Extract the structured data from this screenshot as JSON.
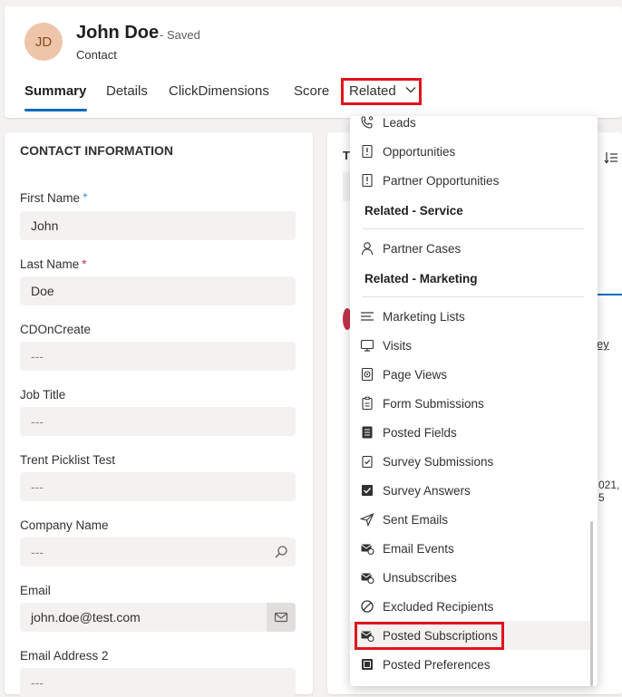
{
  "header": {
    "avatar_initials": "JD",
    "record_name": "John Doe",
    "saved_status": "- Saved",
    "entity_type": "Contact",
    "tabs": [
      {
        "label": "Summary"
      },
      {
        "label": "Details"
      },
      {
        "label": "ClickDimensions"
      },
      {
        "label": "Score"
      },
      {
        "label": "Related"
      }
    ],
    "active_tab": "Summary"
  },
  "contact_info": {
    "section_title": "CONTACT INFORMATION",
    "fields": [
      {
        "label": "First Name",
        "required_marker": "+",
        "value": "John"
      },
      {
        "label": "Last Name",
        "required_marker": "*",
        "value": "Doe"
      },
      {
        "label": "CDOnCreate",
        "value": "---"
      },
      {
        "label": "Job Title",
        "value": "---"
      },
      {
        "label": "Trent Picklist Test",
        "value": "---"
      },
      {
        "label": "Company Name",
        "value": "---",
        "icon": "search-icon"
      },
      {
        "label": "Email",
        "value": "john.doe@test.com",
        "icon": "mail-icon"
      },
      {
        "label": "Email Address 2",
        "value": "---"
      }
    ]
  },
  "right_panel_peek": {
    "letter": "T",
    "partial_text_1": "ey",
    "partial_text_2": "021, 5"
  },
  "related_menu": {
    "items": [
      {
        "type": "item",
        "label": "Leads",
        "icon": "phone-person-icon"
      },
      {
        "type": "item",
        "label": "Opportunities",
        "icon": "opportunity-icon"
      },
      {
        "type": "item",
        "label": "Partner Opportunities",
        "icon": "opportunity-icon"
      },
      {
        "type": "header",
        "label": "Related - Service"
      },
      {
        "type": "item",
        "label": "Partner Cases",
        "icon": "person-icon"
      },
      {
        "type": "header",
        "label": "Related - Marketing"
      },
      {
        "type": "item",
        "label": "Marketing Lists",
        "icon": "list-icon"
      },
      {
        "type": "item",
        "label": "Visits",
        "icon": "monitor-icon"
      },
      {
        "type": "item",
        "label": "Page Views",
        "icon": "page-view-icon"
      },
      {
        "type": "item",
        "label": "Form Submissions",
        "icon": "clipboard-icon"
      },
      {
        "type": "item",
        "label": "Posted Fields",
        "icon": "form-icon"
      },
      {
        "type": "item",
        "label": "Survey Submissions",
        "icon": "survey-icon"
      },
      {
        "type": "item",
        "label": "Survey Answers",
        "icon": "checkbox-icon"
      },
      {
        "type": "item",
        "label": "Sent Emails",
        "icon": "send-icon"
      },
      {
        "type": "item",
        "label": "Email Events",
        "icon": "email-event-icon"
      },
      {
        "type": "item",
        "label": "Unsubscribes",
        "icon": "email-event-icon"
      },
      {
        "type": "item",
        "label": "Excluded Recipients",
        "icon": "block-icon"
      },
      {
        "type": "item",
        "label": "Posted Subscriptions",
        "icon": "email-event-icon",
        "highlighted": true
      },
      {
        "type": "item",
        "label": "Posted Preferences",
        "icon": "preferences-icon"
      }
    ]
  },
  "colors": {
    "accent": "#0f6cbd",
    "highlight_border": "#e0141e",
    "avatar_bg": "#eec5a8"
  }
}
